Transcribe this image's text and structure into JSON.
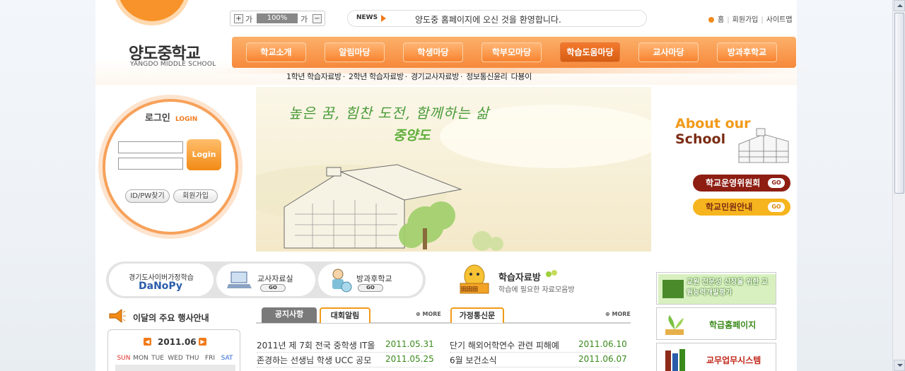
{
  "header": {
    "school_name": "양도중학교",
    "school_name_en": "YANGDO MIDDLE SCHOOL",
    "font_size": {
      "increase": "+",
      "small_label": "가",
      "value": "100%",
      "large_label": "가",
      "decrease": "−"
    },
    "news": {
      "label": "NEWS",
      "text": "양도중 홈페이지에 오신 것을 환영합니다."
    },
    "top_links": [
      "홈",
      "회원가입",
      "사이트맵"
    ]
  },
  "nav": {
    "items": [
      "학교소개",
      "알림마당",
      "학생마당",
      "학부모마당",
      "학습도움마당",
      "교사마당",
      "방과후학교"
    ],
    "active_index": 4,
    "sub_items": [
      "1학년 학습자료방",
      "2학년 학습자료방",
      "경기교사자료방",
      "정보통신윤리",
      "다뵹이"
    ]
  },
  "login": {
    "title": "로그인",
    "title_en": "LOGIN",
    "button": "Login",
    "find_idpw": "ID/PW찾기",
    "join": "회원가입"
  },
  "banner": {
    "slogan": "높은 꿈, 힘찬 도전, 함께하는 삶",
    "name": "중양도"
  },
  "about": {
    "title_line1": "About our",
    "title_line2": "School",
    "buttons": [
      {
        "label": "학교운영위원회",
        "go": "GO"
      },
      {
        "label": "학교민원안내",
        "go": "GO"
      }
    ]
  },
  "quick_links": {
    "danopy": {
      "caption": "경기도사이버가정학습",
      "logo": "DaNoPy"
    },
    "teacher": {
      "label": "교사자료실",
      "go": "GO"
    },
    "afterschool": {
      "label": "방과후학교",
      "go": "GO"
    }
  },
  "study_room": {
    "title": "학습자료방",
    "desc": "학습에 필요한 자료모음방",
    "badge": "田田田"
  },
  "events": {
    "title": "이달의 주요 행사안내"
  },
  "calendar": {
    "month": "2011.06",
    "days": [
      "SUN",
      "MON",
      "TUE",
      "WED",
      "THU",
      "FRI",
      "SAT"
    ]
  },
  "board_tabs": {
    "left": [
      "공지사항",
      "대회알림"
    ],
    "right": [
      "가정통신문"
    ],
    "more": "MORE"
  },
  "board_left": [
    {
      "title": "2011년 제 7회 전국 중학생 IT올",
      "date": "2011.05.31"
    },
    {
      "title": "존경하는 선생님 학생 UCC 공모",
      "date": "2011.05.25"
    }
  ],
  "board_right": [
    {
      "title": "단기 해외어학연수 관련 피해예",
      "date": "2011.06.10"
    },
    {
      "title": "6월 보건소식",
      "date": "2011.06.07"
    }
  ],
  "side_cards": [
    {
      "label": "교원 전문성 신장을 위한 교원능력개발평가"
    },
    {
      "label": "학급홈페이지"
    },
    {
      "label": "교무업무시스템"
    }
  ],
  "colors": {
    "accent_orange": "#f6893b",
    "brand_brown": "#7b2c14",
    "date_green": "#3b8a1c"
  }
}
